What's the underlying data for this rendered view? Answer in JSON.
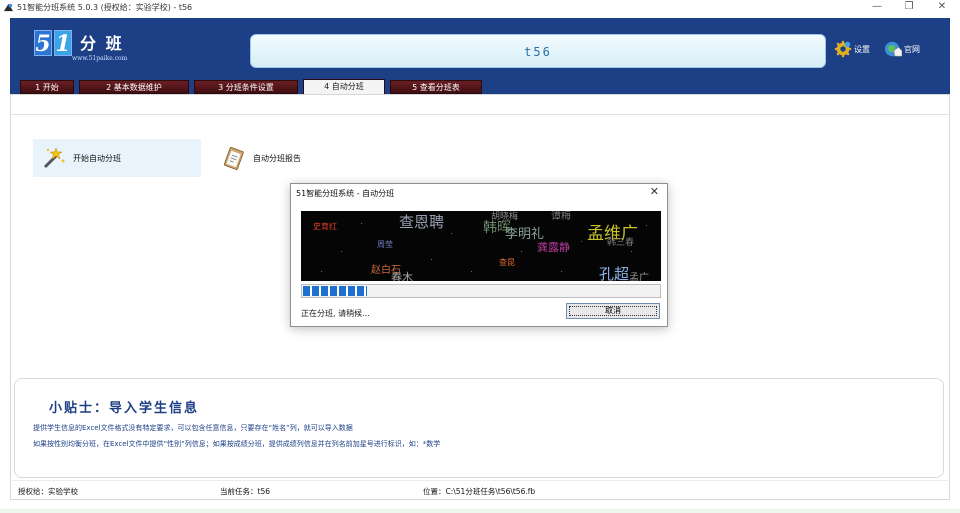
{
  "window": {
    "title": "51智能分班系统 5.0.3 (授权给：实验学校) - t56",
    "controls": [
      "—",
      "❐",
      "✕"
    ]
  },
  "header": {
    "logo_digits": [
      "5",
      "1"
    ],
    "logo_text": "分 班",
    "logo_url": "www.51paike.com",
    "current_task": "t56",
    "settings_label": "设置",
    "website_label": "官网",
    "colors": {
      "banner": "#1c3f86",
      "task_box": "#d6eef8"
    }
  },
  "tabs": [
    {
      "label": "1 开始",
      "active": false
    },
    {
      "label": "2 基本数据维护",
      "active": false
    },
    {
      "label": "3 分班条件设置",
      "active": false
    },
    {
      "label": "4 自动分班",
      "active": true
    },
    {
      "label": "5 查看分班表",
      "active": false
    }
  ],
  "actions": {
    "start_label": "开始自动分班",
    "report_label": "自动分班报告"
  },
  "dialog": {
    "title": "51智能分班系统 - 自动分班",
    "close": "✕",
    "status": "正在分班, 请稍候...",
    "cancel_label": "取消",
    "progress": 0.18,
    "names": [
      "史育红",
      "查恩聘",
      "胡晓梅",
      "韩晖",
      "李明礼",
      "孟维广",
      "周莹",
      "龚露静",
      "韩三春",
      "赵白石",
      "查昆",
      "孔超",
      "谭梅",
      "春木",
      "孟广"
    ]
  },
  "tips": {
    "title": "小贴士：导入学生信息",
    "line1": "提供学生信息的Excel文件格式没有特定要求，可以包含任意信息，只要存在“姓名”列，就可以导入数据",
    "line2": "如果按性别均衡分班，在Excel文件中提供“性别”列信息；如果按成绩分班，提供成绩列信息并在列名前加星号进行标识，如：*数学"
  },
  "status": {
    "licensed": "授权给：实验学校",
    "current_task": "当前任务：t56",
    "location": "位置：C:\\51分班任务\\t56\\t56.fb"
  }
}
